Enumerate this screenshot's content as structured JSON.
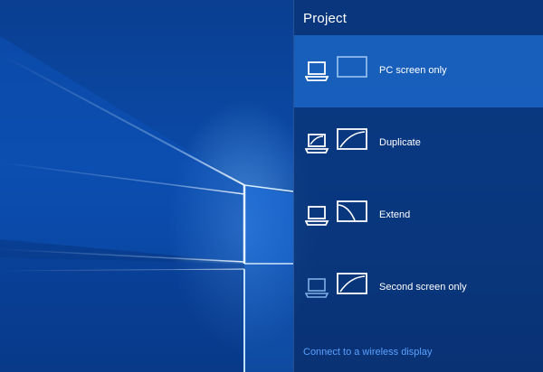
{
  "panel": {
    "title": "Project",
    "options": [
      {
        "label": "PC screen only",
        "selected": true,
        "icon": "pc-screen-only-icon"
      },
      {
        "label": "Duplicate",
        "selected": false,
        "icon": "duplicate-icon"
      },
      {
        "label": "Extend",
        "selected": false,
        "icon": "extend-icon"
      },
      {
        "label": "Second screen only",
        "selected": false,
        "icon": "second-screen-only-icon"
      }
    ],
    "wireless_link": "Connect to a wireless display"
  },
  "colors": {
    "accent": "#1e6ed2",
    "link": "#5aa0ff",
    "panel_bg": "#0a3478"
  }
}
